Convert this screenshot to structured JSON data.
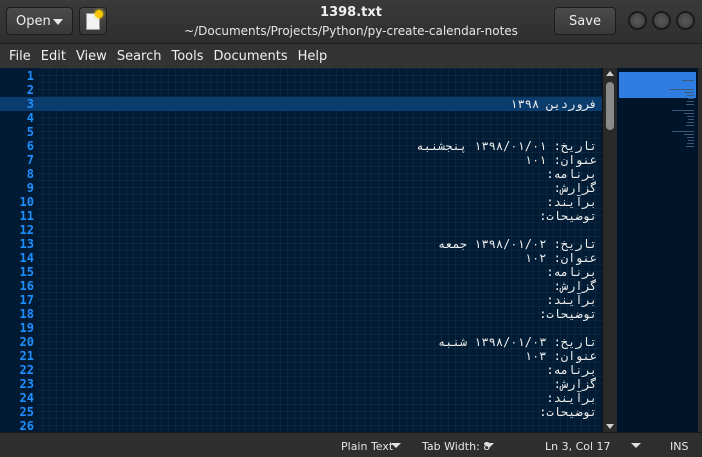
{
  "toolbar": {
    "open_label": "Open",
    "save_label": "Save"
  },
  "window": {
    "file_name": "1398.txt",
    "path": "~/Documents/Projects/Python/py-create-calendar-notes"
  },
  "menu": [
    "File",
    "Edit",
    "View",
    "Search",
    "Tools",
    "Documents",
    "Help"
  ],
  "editor": {
    "current_line": 3,
    "lines": [
      {
        "n": "1",
        "text": ""
      },
      {
        "n": "2",
        "text": ""
      },
      {
        "n": "3",
        "text": "فروردین ۱۳۹۸"
      },
      {
        "n": "4",
        "text": ""
      },
      {
        "n": "5",
        "text": ""
      },
      {
        "n": "6",
        "text": "تاریخ: ۱۳۹۸/۰۱/۰۱ پنجشنبه"
      },
      {
        "n": "7",
        "text": "عنوان: ۱۰۱"
      },
      {
        "n": "8",
        "text": "برنامه:"
      },
      {
        "n": "9",
        "text": "گزارش:"
      },
      {
        "n": "10",
        "text": "برآیند:"
      },
      {
        "n": "11",
        "text": "توضیحات:"
      },
      {
        "n": "12",
        "text": ""
      },
      {
        "n": "13",
        "text": "تاریخ: ۱۳۹۸/۰۱/۰۲ جمعه"
      },
      {
        "n": "14",
        "text": "عنوان: ۱۰۲"
      },
      {
        "n": "15",
        "text": "برنامه:"
      },
      {
        "n": "16",
        "text": "گزارش:"
      },
      {
        "n": "17",
        "text": "برآیند:"
      },
      {
        "n": "18",
        "text": "توضیحات:"
      },
      {
        "n": "19",
        "text": ""
      },
      {
        "n": "20",
        "text": "تاریخ: ۱۳۹۸/۰۱/۰۳ شنبه"
      },
      {
        "n": "21",
        "text": "عنوان: ۱۰۳"
      },
      {
        "n": "22",
        "text": "برنامه:"
      },
      {
        "n": "23",
        "text": "گزارش:"
      },
      {
        "n": "24",
        "text": "برآیند:"
      },
      {
        "n": "25",
        "text": "توضیحات:"
      },
      {
        "n": "26",
        "text": ""
      }
    ]
  },
  "status": {
    "language": "Plain Text",
    "tab_width": "Tab Width: 8",
    "position": "Ln 3, Col 17",
    "mode": "INS"
  },
  "colors": {
    "editor_bg": "#001b33",
    "line_number": "#1e8fff",
    "current_line": "#0b3c6e",
    "minimap_viewport": "#2f7de0"
  },
  "icons": {
    "new_document": "new-document-icon",
    "dropdown": "chevron-down-icon",
    "window_controls": "circle-icon"
  }
}
